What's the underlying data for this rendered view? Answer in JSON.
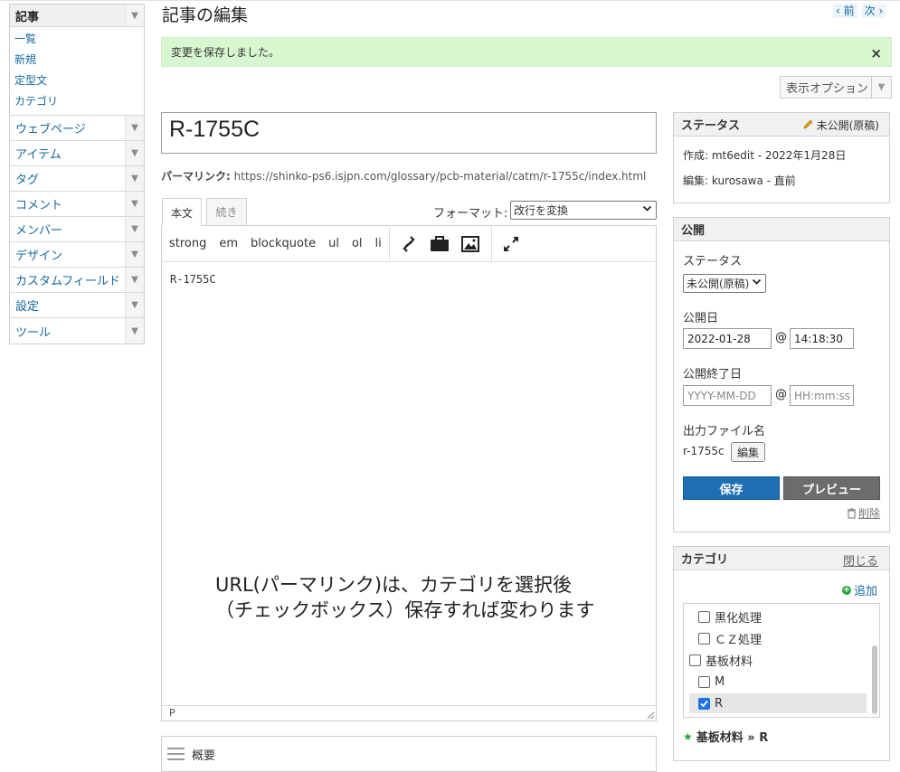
{
  "sidebar": {
    "active_section": {
      "label": "記事",
      "items": [
        "一覧",
        "新規",
        "定型文",
        "カテゴリ"
      ]
    },
    "sections": [
      "ウェブページ",
      "アイテム",
      "タグ",
      "コメント",
      "メンバー",
      "デザイン",
      "カスタムフィールド",
      "設定",
      "ツール"
    ]
  },
  "header": {
    "title": "記事の編集",
    "prev": "‹ 前",
    "next": "次 ›"
  },
  "message": {
    "text": "変更を保存しました。"
  },
  "display_options": {
    "label": "表示オプション"
  },
  "entry": {
    "title": "R-1755C",
    "permalink_label": "パーマリンク:",
    "permalink_url": "https://shinko-ps6.isjpn.com/glossary/pcb-material/catm/r-1755c/index.html"
  },
  "editor": {
    "tabs": [
      "本文",
      "続き"
    ],
    "format_label": "フォーマット:",
    "format_value": "改行を変換",
    "toolbar": [
      "strong",
      "em",
      "blockquote",
      "ul",
      "ol",
      "li"
    ],
    "content": "R-1755C",
    "status": "P"
  },
  "annotation": {
    "line1": "URL(パーマリンク)は、カテゴリを選択後",
    "line2": "（チェックボックス）保存すれば変わります"
  },
  "summary": {
    "label": "概要"
  },
  "status_widget": {
    "title": "ステータス",
    "state": "未公開(原稿)",
    "created": "作成: mt6edit - 2022年1月28日",
    "edited": "編集: kurosawa - 直前"
  },
  "publish_widget": {
    "title": "公開",
    "status_label": "ステータス",
    "status_value": "未公開(原稿)",
    "date_label": "公開日",
    "date": "2022-01-28",
    "time": "14:18:30",
    "end_label": "公開終了日",
    "end_date_placeholder": "YYYY-MM-DD",
    "end_time_placeholder": "HH:mm:ss",
    "at": "@",
    "filename_label": "出力ファイル名",
    "filename": "r-1755c",
    "edit_button": "編集",
    "save_button": "保存",
    "preview_button": "プレビュー",
    "delete_link": "削除"
  },
  "category_widget": {
    "title": "カテゴリ",
    "close": "閉じる",
    "add": "追加",
    "items": [
      {
        "label": "黒化処理",
        "checked": false
      },
      {
        "label": "ＣＺ処理",
        "checked": false
      },
      {
        "label": "基板材料",
        "checked": false
      },
      {
        "label": "M",
        "checked": false
      },
      {
        "label": "R",
        "checked": true
      }
    ],
    "selected": "基板材料 » R"
  },
  "colors": {
    "link": "#15699f",
    "success_bg": "#d8f6d0",
    "save_button": "#1f6fb5",
    "preview_button": "#6c6c6c",
    "checkbox_checked": "#1a73e8"
  }
}
